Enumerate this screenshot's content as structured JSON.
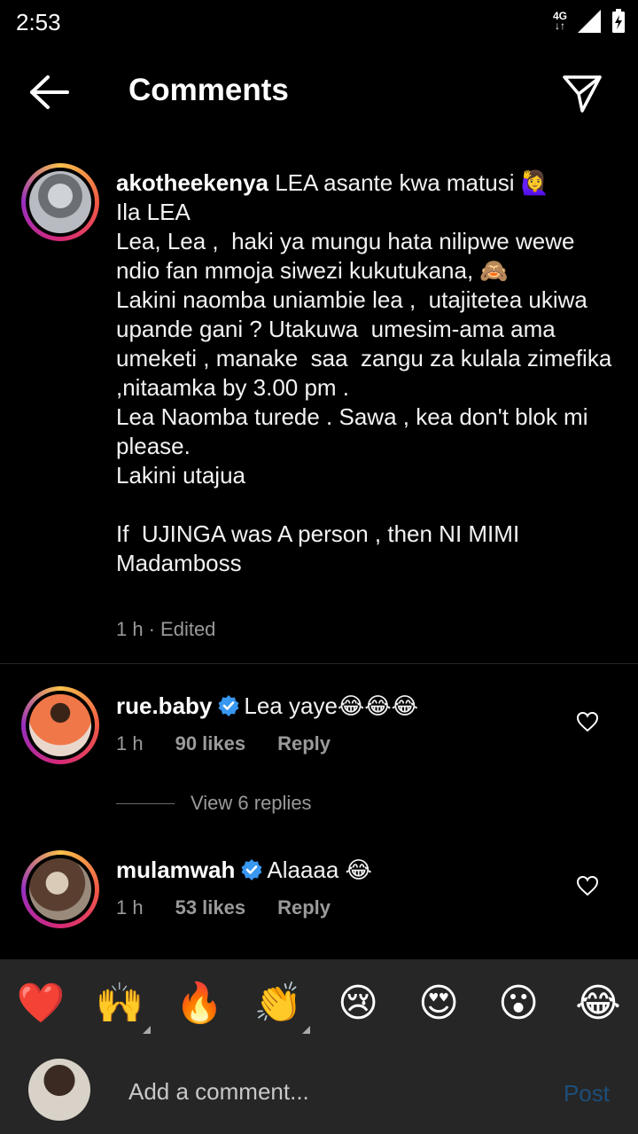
{
  "status_bar": {
    "time": "2:53",
    "network_top": "4G",
    "network_arrows": "↓↑"
  },
  "header": {
    "title": "Comments",
    "back_icon": "arrow-left-icon",
    "send_icon": "paper-plane-icon"
  },
  "comments": [
    {
      "username": "akotheekenya",
      "verified": false,
      "text": "LEA asante kwa matusi 🙋‍♀️\nIla LEA\nLea, Lea ,  haki ya mungu hata nilipwe wewe ndio fan mmoja siwezi kukutukana, 🙈\nLakini naomba uniambie lea ,  utajitetea ukiwa upande gani ? Utakuwa  umesim-ama ama umeketi , manake  saa  zangu za kulala zimefika ,nitaamka by 3.00 pm .\nLea Naomba turede . Sawa , kea don't blok mi please.\nLakini utajua\n\nIf  UJINGA was A person , then NI MIMI Madamboss",
      "time": "1 h",
      "edited": "· Edited"
    },
    {
      "username": "rue.baby",
      "verified": true,
      "text": "Lea yaye😂😂😂",
      "time": "1 h",
      "likes": "90 likes",
      "reply": "Reply",
      "view_replies": "View 6 replies"
    },
    {
      "username": "mulamwah",
      "verified": true,
      "text": "Alaaaa 😂",
      "time": "1 h",
      "likes": "53 likes",
      "reply": "Reply"
    }
  ],
  "reactions": [
    "❤️",
    "🙌",
    "🔥",
    "👏",
    "😢",
    "😍",
    "😮",
    "😂"
  ],
  "composer": {
    "placeholder": "Add a comment...",
    "post_label": "Post"
  },
  "colors": {
    "background": "#000000",
    "secondary_text": "#9a9a9a",
    "verified_blue": "#3897f0",
    "composer_bg": "#262626",
    "post_disabled": "#1d4e7a"
  }
}
